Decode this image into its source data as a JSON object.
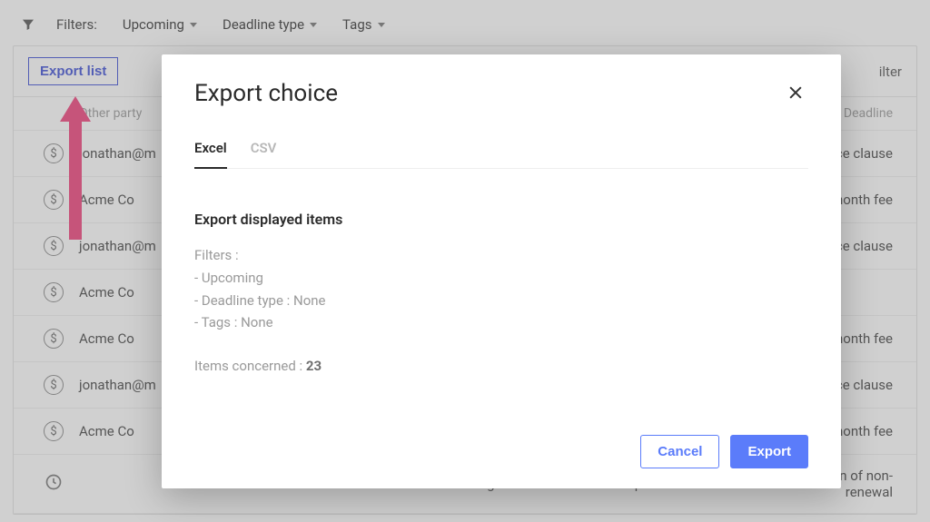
{
  "filters_bar": {
    "label": "Filters:",
    "upcoming": "Upcoming",
    "deadline_type": "Deadline type",
    "tags": "Tags"
  },
  "toolbar": {
    "export_list": "Export list",
    "right_link": "ilter"
  },
  "columns": {
    "other_party": "Other party",
    "deadline": "Deadline"
  },
  "rows": [
    {
      "icon": "dollar",
      "party": "jonathan@m",
      "deadline": "ice clause"
    },
    {
      "icon": "dollar",
      "party": "Acme Co",
      "deadline": "month fee"
    },
    {
      "icon": "dollar",
      "party": "jonathan@m",
      "deadline": "ice clause"
    },
    {
      "icon": "dollar",
      "party": "Acme Co",
      "deadline": ""
    },
    {
      "icon": "dollar",
      "party": "Acme Co",
      "deadline": "month fee"
    },
    {
      "icon": "dollar",
      "party": "jonathan@m",
      "deadline": "ice clause"
    },
    {
      "icon": "dollar",
      "party": "Acme Co",
      "deadline": "month fee"
    },
    {
      "icon": "clock",
      "party": "",
      "deadline": ""
    }
  ],
  "last_row_center": "Lease Agreement - Dattons Compa...",
  "last_row_right": "Notification of non-renewal",
  "modal": {
    "title": "Export choice",
    "tabs": {
      "excel": "Excel",
      "csv": "CSV"
    },
    "subtitle": "Export displayed items",
    "filters_label": "Filters :",
    "filter_lines": [
      "- Upcoming",
      "- Deadline type : None",
      "- Tags : None"
    ],
    "items_label": "Items concerned : ",
    "items_count": "23",
    "cancel": "Cancel",
    "export": "Export"
  }
}
